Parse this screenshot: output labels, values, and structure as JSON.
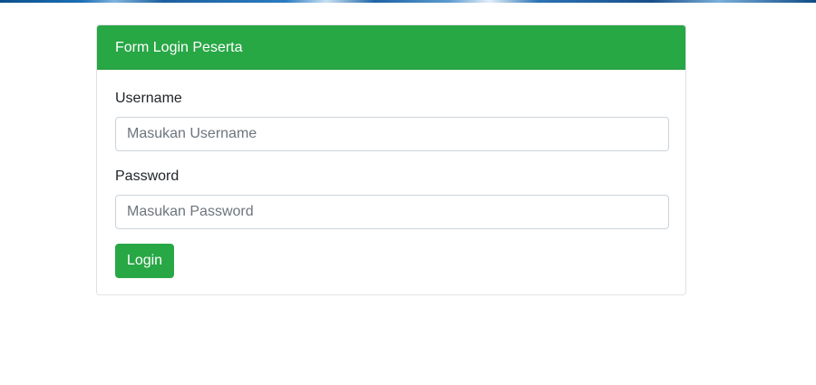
{
  "form": {
    "title": "Form Login Peserta",
    "username_label": "Username",
    "username_placeholder": "Masukan Username",
    "password_label": "Password",
    "password_placeholder": "Masukan Password",
    "submit_label": "Login"
  },
  "colors": {
    "accent": "#28a745",
    "banner": "#1b6fb5"
  }
}
